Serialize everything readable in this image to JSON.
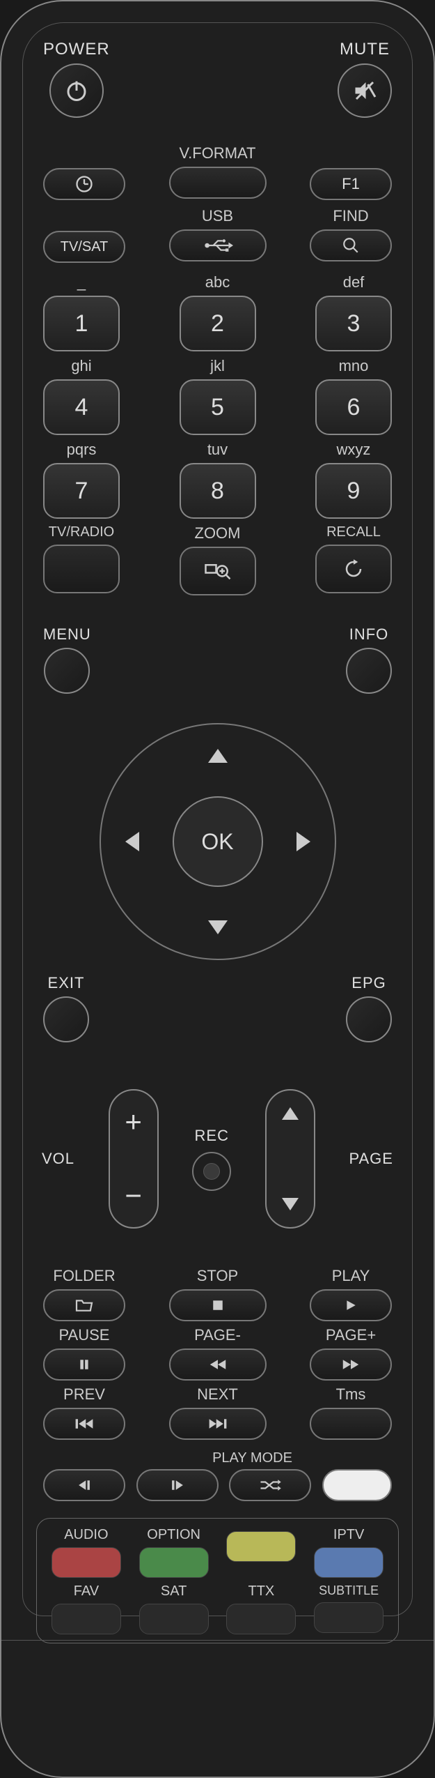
{
  "top": {
    "power": "POWER",
    "mute": "MUTE"
  },
  "row2": {
    "vformat": "V.FORMAT",
    "f1": "F1"
  },
  "row3": {
    "tvsat": "TV/SAT",
    "usb": "USB",
    "find": "FIND"
  },
  "keypad": {
    "r1": {
      "la": "_",
      "lb": "abc",
      "lc": "def",
      "a": "1",
      "b": "2",
      "c": "3"
    },
    "r2": {
      "la": "ghi",
      "lb": "jkl",
      "lc": "mno",
      "a": "4",
      "b": "5",
      "c": "6"
    },
    "r3": {
      "la": "pqrs",
      "lb": "tuv",
      "lc": "wxyz",
      "a": "7",
      "b": "8",
      "c": "9"
    },
    "r4": {
      "la": "TV/RADIO",
      "lb": "ZOOM",
      "lc": "RECALL"
    }
  },
  "mid": {
    "menu": "MENU",
    "info": "INFO",
    "ok": "OK",
    "exit": "EXIT",
    "epg": "EPG"
  },
  "rocker": {
    "vol": "VOL",
    "rec": "REC",
    "page": "PAGE"
  },
  "media": {
    "r1": {
      "la": "FOLDER",
      "lb": "STOP",
      "lc": "PLAY"
    },
    "r2": {
      "la": "PAUSE",
      "lb": "PAGE-",
      "lc": "PAGE+"
    },
    "r3": {
      "la": "PREV",
      "lb": "NEXT",
      "lc": "Tms"
    },
    "r4": {
      "lb": "PLAY MODE"
    }
  },
  "colors": {
    "top": {
      "a": "AUDIO",
      "b": "OPTION",
      "c": "",
      "d": "IPTV"
    },
    "bot": {
      "a": "FAV",
      "b": "SAT",
      "c": "TTX",
      "d": "SUBTITLE"
    }
  }
}
